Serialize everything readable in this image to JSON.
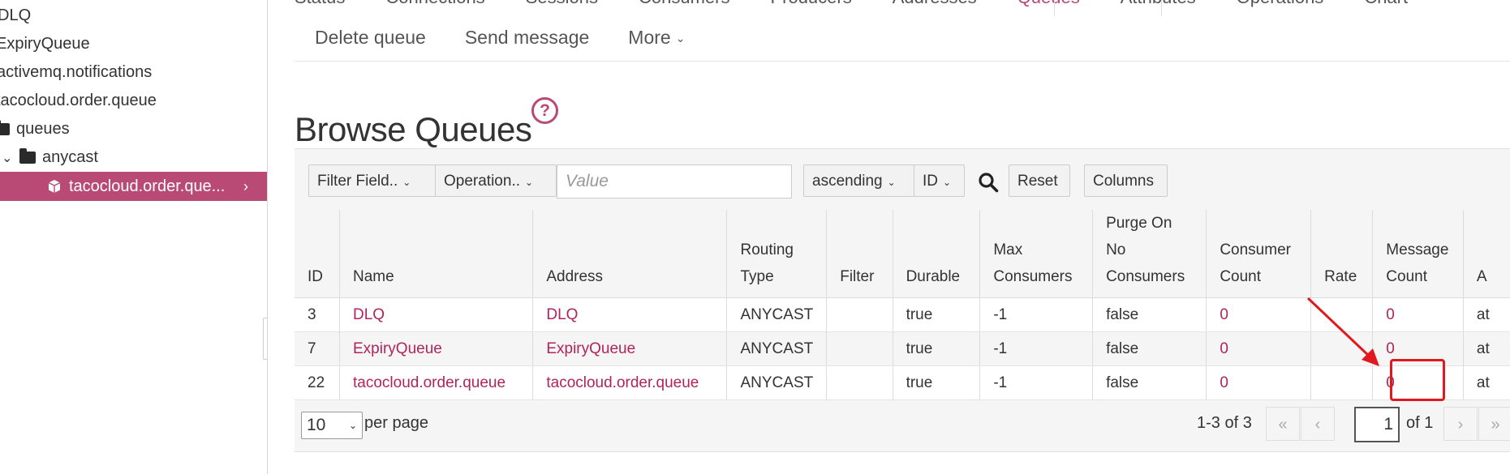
{
  "sidebar": {
    "items": [
      {
        "label": "DLQ"
      },
      {
        "label": "ExpiryQueue"
      },
      {
        "label": "activemq.notifications"
      },
      {
        "label": "tacocloud.order.queue"
      },
      {
        "label": "queues"
      },
      {
        "label": "anycast"
      }
    ],
    "selected": {
      "label": "tacocloud.order.que..."
    }
  },
  "nav": {
    "tabs": [
      {
        "label": "Status"
      },
      {
        "label": "Connections"
      },
      {
        "label": "Sessions"
      },
      {
        "label": "Consumers"
      },
      {
        "label": "Producers"
      },
      {
        "label": "Addresses"
      },
      {
        "label": "Queues",
        "active": true
      },
      {
        "label": "Attributes"
      },
      {
        "label": "Operations"
      },
      {
        "label": "Chart"
      }
    ],
    "sub": {
      "delete_queue": "Delete queue",
      "send_message": "Send message",
      "more": "More"
    }
  },
  "page": {
    "title": "Browse Queues"
  },
  "toolbar": {
    "filter_field": "Filter Field..",
    "operation": "Operation..",
    "value_placeholder": "Value",
    "sort_order": "ascending",
    "sort_field": "ID",
    "reset": "Reset",
    "columns": "Columns"
  },
  "table": {
    "headers": [
      "ID",
      "Name",
      "Address",
      "Routing\nType",
      "Filter",
      "Durable",
      "Max\nConsumers",
      "Purge On\nNo\nConsumers",
      "Consumer\nCount",
      "Rate",
      "Message\nCount",
      "A"
    ],
    "rows": [
      {
        "id": "3",
        "name": "DLQ",
        "address": "DLQ",
        "routing": "ANYCAST",
        "filter": "",
        "durable": "true",
        "max_consumers": "-1",
        "purge": "false",
        "consumer_count": "0",
        "rate": "",
        "message_count": "0",
        "extra": "at"
      },
      {
        "id": "7",
        "name": "ExpiryQueue",
        "address": "ExpiryQueue",
        "routing": "ANYCAST",
        "filter": "",
        "durable": "true",
        "max_consumers": "-1",
        "purge": "false",
        "consumer_count": "0",
        "rate": "",
        "message_count": "0",
        "extra": "at"
      },
      {
        "id": "22",
        "name": "tacocloud.order.queue",
        "address": "tacocloud.order.queue",
        "routing": "ANYCAST",
        "filter": "",
        "durable": "true",
        "max_consumers": "-1",
        "purge": "false",
        "consumer_count": "0",
        "rate": "",
        "message_count": "0",
        "extra": "at"
      }
    ]
  },
  "pager": {
    "per_page": "10",
    "per_page_label": "per page",
    "range": "1-3 of 3",
    "page": "1",
    "of": "of 1"
  },
  "colors": {
    "accent": "#b94a75",
    "link": "#b0245a",
    "annotation": "#e0191e"
  }
}
